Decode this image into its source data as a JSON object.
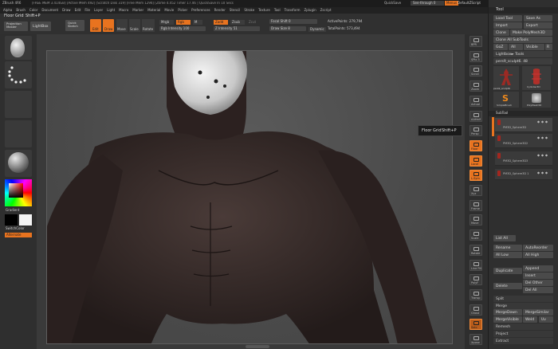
{
  "titlebar": {
    "app": "ZBrush 4R6",
    "stats": "[FREE MEM 3.414GB] [Active Mem 492] [Scratch Disk 319] [Free Mem 1294] [Ztime 4.452 Timer 17.46 ] QuickSave In 10 Secs",
    "quicksave": "QuickSave",
    "seethrough": "See-through  0",
    "menus": "Menus",
    "script": "DefaultZScript"
  },
  "menubar": {
    "items": [
      "Alpha",
      "Brush",
      "Color",
      "Document",
      "Draw",
      "Edit",
      "File",
      "Layer",
      "Light",
      "Macro",
      "Marker",
      "Material",
      "Movie",
      "Picker",
      "Preferences",
      "Render",
      "Stencil",
      "Stroke",
      "Texture",
      "Tool",
      "Transform",
      "Zplugin",
      "Zscript"
    ]
  },
  "tooltip_bar": {
    "label": "Floor Grid",
    "shortcut": "Shift+P"
  },
  "toolbar": {
    "projection_master": "Projection Master",
    "lightbox": "LightBox",
    "quick_sketch": "Quick Sketch",
    "edit": "Edit",
    "draw": "Draw",
    "move": "Move",
    "scale": "Scale",
    "rotate": "Rotate",
    "mrgb": "Mrgb",
    "rgb": "Rgb",
    "m": "M",
    "rgb_intensity": "Rgb Intensity 100",
    "zadd": "Zadd",
    "zsub": "Zsub",
    "zcut": "Zcut",
    "z_intensity": "Z Intensity 51",
    "focal_shift": "Focal Shift 0",
    "draw_size": "Draw Size 8",
    "dynamic": "Dynamic",
    "active_points": "ActivePoints: 279,794",
    "total_points": "TotalPoints: 573,494"
  },
  "left_shelf": {
    "gradient": "Gradient",
    "switch_color": "SwitchColor",
    "alternate": "Alternate"
  },
  "right_shelf": [
    {
      "name": "bpr",
      "label": "BPR"
    },
    {
      "name": "spix",
      "label": "SPix 3"
    },
    {
      "name": "scroll",
      "label": "Scroll"
    },
    {
      "name": "zoom",
      "label": "Zoom"
    },
    {
      "name": "actual",
      "label": "Actual"
    },
    {
      "name": "aahalf",
      "label": "AAHalf"
    },
    {
      "name": "persp",
      "label": "Persp"
    },
    {
      "name": "floor",
      "label": "Floor"
    },
    {
      "name": "local",
      "label": "Local"
    },
    {
      "name": "lsym",
      "label": "L.Sym"
    },
    {
      "name": "xyz",
      "label": "Xyz"
    },
    {
      "name": "frame",
      "label": "Frame"
    },
    {
      "name": "move",
      "label": "Move"
    },
    {
      "name": "scale",
      "label": "Scale"
    },
    {
      "name": "rotate",
      "label": "Rotate"
    },
    {
      "name": "line-fill",
      "label": "Line Fill"
    },
    {
      "name": "polyf",
      "label": "PolyF"
    },
    {
      "name": "transp",
      "label": "Transp"
    },
    {
      "name": "ghost",
      "label": "Ghost"
    },
    {
      "name": "solo",
      "label": "Solo"
    },
    {
      "name": "xpose",
      "label": "Xpose"
    }
  ],
  "floor_tooltip": {
    "label": "Floor Grid",
    "shortcut": "Shift+P"
  },
  "tool_panel": {
    "title": "Tool",
    "load_tool": "Load Tool",
    "save_as": "Save As",
    "import": "Import",
    "export": "Export",
    "clone": "Clone",
    "make_polymesh": "Make PolyMesh3D",
    "clone_all": "Clone All SubTools",
    "goz": "GoZ",
    "all": "All",
    "visible": "Visible",
    "r": "R",
    "lightbox_tools": "Lightbox► Tools",
    "current_tool": "pers9_sculpt6. 48",
    "thumbs": [
      {
        "label": "pers9_sculpt6"
      },
      {
        "label": "Cylinder3D"
      },
      {
        "label": "SimpleBrush"
      },
      {
        "label": "PolyMesh3D"
      }
    ],
    "subtool": "SubTool",
    "subtools": [
      "PM3D_Sphere3D",
      "PM3D_Sphere3D2",
      "PM3D_Sphere3D3",
      "PM3D_Sphere3D 1"
    ],
    "list_all": "List All",
    "rename": "Rename",
    "autoreorder": "AutoReorder",
    "all_low": "All Low",
    "all_high": "All High",
    "duplicate": "Duplicate",
    "append": "Append",
    "insert": "Insert",
    "delete": "Delete",
    "del_other": "Del Other",
    "del_all": "Del All",
    "split": "Split",
    "merge": "Merge",
    "merge_down": "MergeDown",
    "merge_similar": "MergeSimilar",
    "merge_visible": "MergeVisible",
    "weld": "Weld",
    "uv": "Uv",
    "remesh": "Remesh",
    "project": "Project",
    "extract": "Extract"
  }
}
